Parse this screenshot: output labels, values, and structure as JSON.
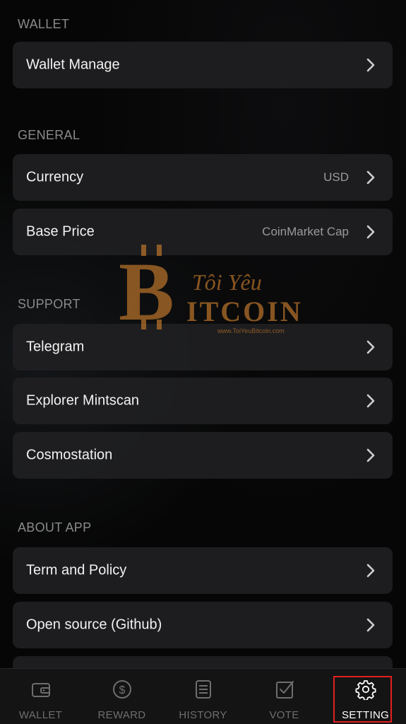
{
  "sections": {
    "wallet": {
      "title": "WALLET"
    },
    "general": {
      "title": "GENERAL"
    },
    "support": {
      "title": "SUPPORT"
    },
    "about": {
      "title": "ABOUT APP"
    }
  },
  "rows": {
    "wallet_manage": {
      "label": "Wallet Manage",
      "icon": "chevron-right-icon"
    },
    "currency": {
      "label": "Currency",
      "value": "USD",
      "icon": "chevron-right-icon"
    },
    "base_price": {
      "label": "Base Price",
      "value": "CoinMarket Cap",
      "icon": "chevron-right-icon"
    },
    "telegram": {
      "label": "Telegram",
      "icon": "chevron-right-icon"
    },
    "explorer": {
      "label": "Explorer Mintscan",
      "icon": "chevron-right-icon"
    },
    "cosmostation": {
      "label": "Cosmostation",
      "icon": "chevron-right-icon"
    },
    "term_policy": {
      "label": "Term and Policy",
      "icon": "chevron-right-icon"
    },
    "open_source": {
      "label": "Open source (Github)",
      "icon": "chevron-right-icon"
    }
  },
  "tabs": [
    {
      "label": "WALLET",
      "icon": "wallet-icon",
      "active": false
    },
    {
      "label": "REWARD",
      "icon": "dollar-coin-icon",
      "active": false
    },
    {
      "label": "HISTORY",
      "icon": "list-document-icon",
      "active": false
    },
    {
      "label": "VOTE",
      "icon": "checkbox-icon",
      "active": false
    },
    {
      "label": "SETTING",
      "icon": "gear-icon",
      "active": true
    }
  ],
  "watermark": {
    "logo_text": "BITCOIN",
    "tagline": "Tôi Yêu",
    "url": "www.ToiYeuBitcoin.com"
  },
  "colors": {
    "background": "#060606",
    "row_background": "#202022",
    "section_header": "#8a8a8a",
    "text_primary": "#f2f2f2",
    "text_secondary": "#9a9a9a",
    "tab_inactive": "#6e6e6e",
    "tab_active": "#ffffff",
    "highlight": "#e02020",
    "watermark": "#b8732a"
  }
}
